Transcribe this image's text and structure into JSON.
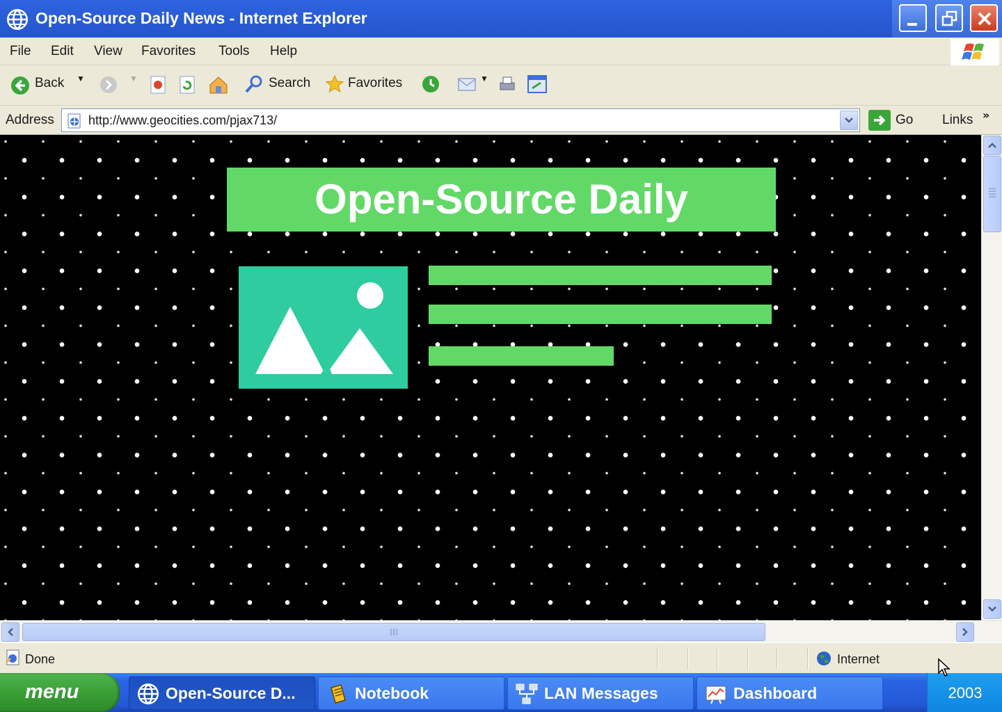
{
  "window": {
    "title": "Open-Source Daily News - Internet Explorer"
  },
  "menubar": {
    "items": [
      "File",
      "Edit",
      "View",
      "Favorites",
      "Tools",
      "Help"
    ]
  },
  "toolbar": {
    "back_label": "Back",
    "search_label": "Search",
    "favorites_label": "Favorites"
  },
  "addressbar": {
    "label": "Address",
    "url": "http://www.geocities.com/pjax713/",
    "go_label": "Go",
    "links_label": "Links"
  },
  "page": {
    "site_title": "Open-Source Daily",
    "article_image_icon": "image-placeholder-icon",
    "text_line_fill": [
      1.0,
      1.0,
      0.54
    ]
  },
  "statusbar": {
    "status_text": "Done",
    "zone_text": "Internet"
  },
  "taskbar": {
    "start_label": "menu",
    "tasks": [
      {
        "label": "Open-Source D...",
        "icon": "globe-icon",
        "active": true
      },
      {
        "label": "Notebook",
        "icon": "notebook-icon",
        "active": false
      },
      {
        "label": "LAN Messages",
        "icon": "network-icon",
        "active": false
      },
      {
        "label": "Dashboard",
        "icon": "dashboard-icon",
        "active": false
      }
    ],
    "clock": "2003"
  },
  "colors": {
    "accent_green": "#62d966",
    "image_teal": "#2ecc9f",
    "titlebar_blue": "#2a5cd6",
    "page_background": "#000000"
  }
}
